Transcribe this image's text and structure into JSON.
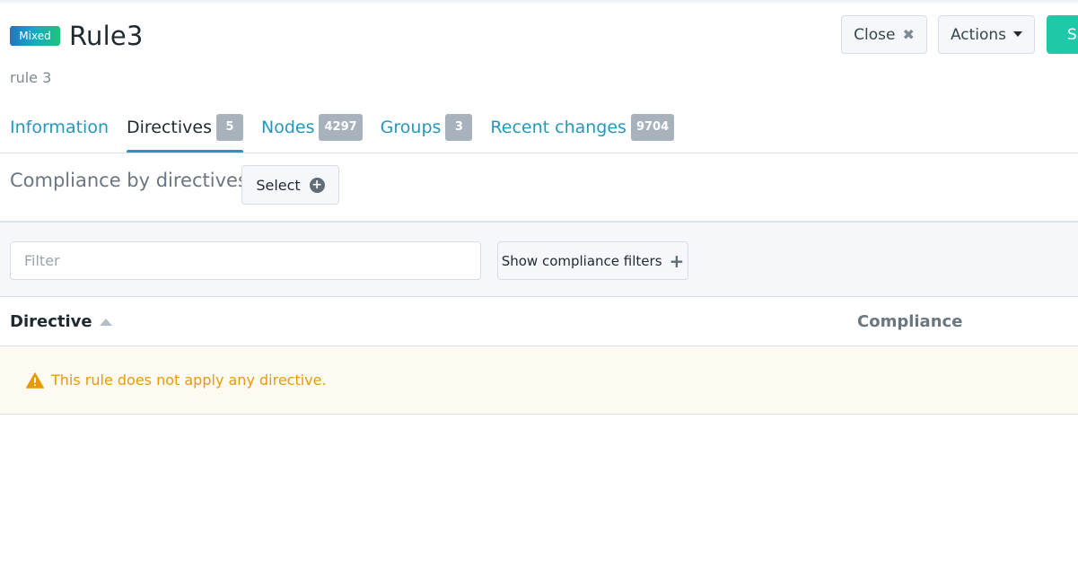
{
  "header": {
    "badge": "Mixed",
    "title": "Rule3",
    "subtitle": "rule 3",
    "close_label": "Close",
    "actions_label": "Actions",
    "save_label": "Save",
    "badge_gradient": [
      "#1e75c4",
      "#22c17a"
    ],
    "save_color": "#1ec8a8"
  },
  "tabs": [
    {
      "label": "Information",
      "count": null,
      "active": false
    },
    {
      "label": "Directives",
      "count": "5",
      "active": true
    },
    {
      "label": "Nodes",
      "count": "4297",
      "active": false
    },
    {
      "label": "Groups",
      "count": "3",
      "active": false
    },
    {
      "label": "Recent changes",
      "count": "9704",
      "active": false
    }
  ],
  "compliance": {
    "title": "Compliance by directives",
    "select_label": "Select"
  },
  "filter": {
    "placeholder": "Filter",
    "value": "",
    "show_filters_label": "Show compliance filters"
  },
  "table": {
    "columns": [
      "Directive",
      "Compliance"
    ],
    "sort_column": "Directive",
    "sort_direction": "ascending",
    "empty_message": "This rule does not apply any directive."
  },
  "colors": {
    "accent": "#2597bd",
    "warning": "#e59b09",
    "badge_count": "#a8b2bd"
  },
  "icons": {
    "close": "close-icon",
    "actions": "caret-down-icon",
    "select": "plus-circle-icon",
    "show_filters": "plus-icon",
    "sort": "sort-up-icon",
    "warning": "warning-triangle-icon"
  }
}
